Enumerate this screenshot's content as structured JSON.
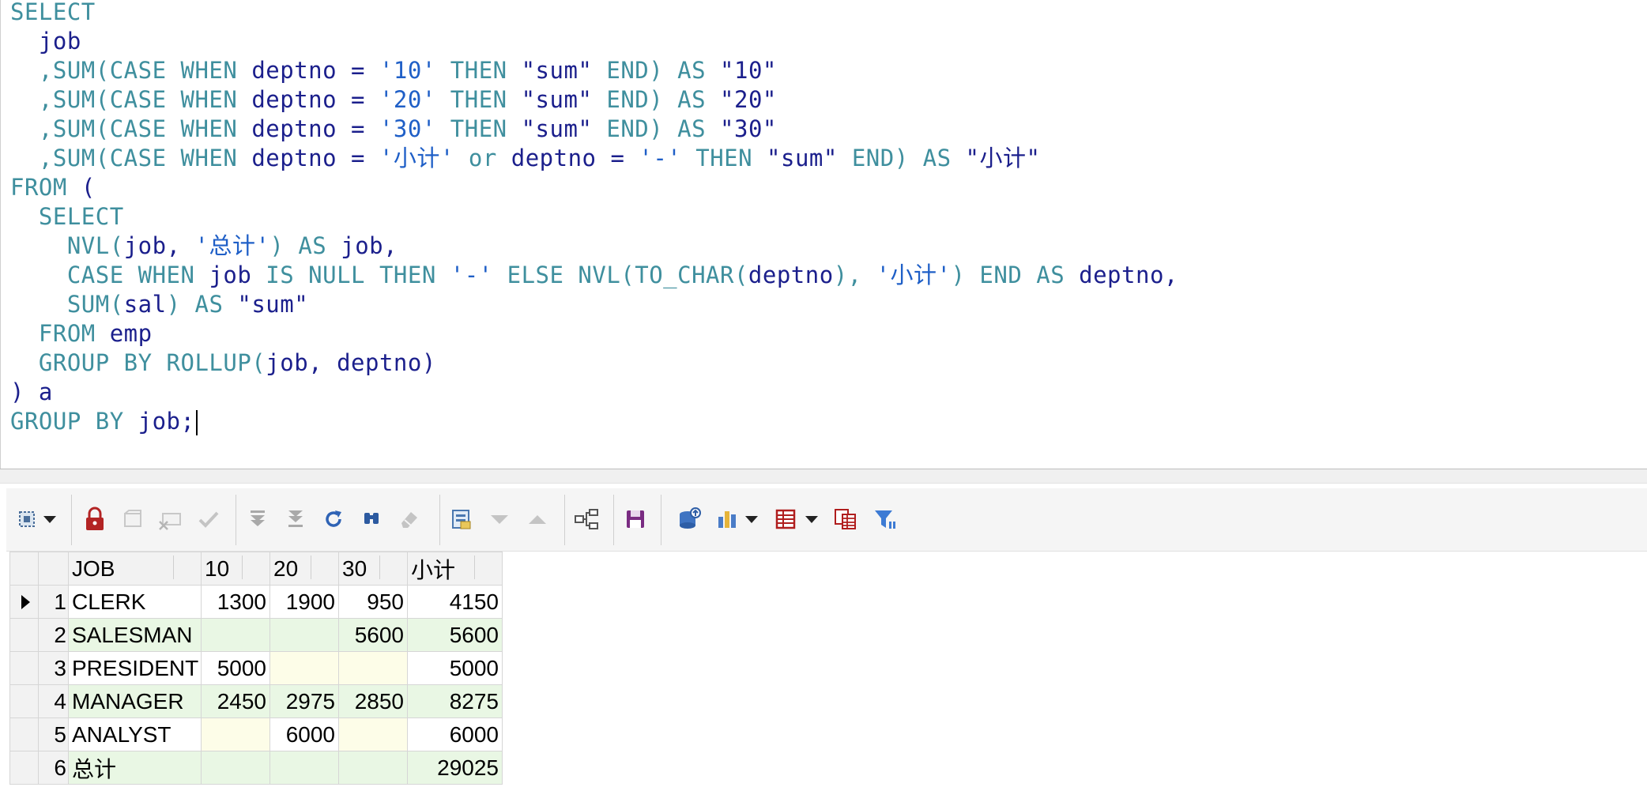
{
  "editor": {
    "lines": [
      [
        {
          "t": "SELECT",
          "k": "kw"
        }
      ],
      [
        {
          "t": "  job",
          "k": "id"
        }
      ],
      [
        {
          "t": "  ,SUM(",
          "k": "kw"
        },
        {
          "t": "CASE WHEN ",
          "k": "kw"
        },
        {
          "t": "deptno ",
          "k": "id"
        },
        {
          "t": "= ",
          "k": "id"
        },
        {
          "t": "'10' ",
          "k": "str"
        },
        {
          "t": "THEN ",
          "k": "kw"
        },
        {
          "t": "\"sum\" ",
          "k": "dstr"
        },
        {
          "t": "END) AS ",
          "k": "kw"
        },
        {
          "t": "\"10\"",
          "k": "dstr"
        }
      ],
      [
        {
          "t": "  ,SUM(",
          "k": "kw"
        },
        {
          "t": "CASE WHEN ",
          "k": "kw"
        },
        {
          "t": "deptno ",
          "k": "id"
        },
        {
          "t": "= ",
          "k": "id"
        },
        {
          "t": "'20' ",
          "k": "str"
        },
        {
          "t": "THEN ",
          "k": "kw"
        },
        {
          "t": "\"sum\" ",
          "k": "dstr"
        },
        {
          "t": "END) AS ",
          "k": "kw"
        },
        {
          "t": "\"20\"",
          "k": "dstr"
        }
      ],
      [
        {
          "t": "  ,SUM(",
          "k": "kw"
        },
        {
          "t": "CASE WHEN ",
          "k": "kw"
        },
        {
          "t": "deptno ",
          "k": "id"
        },
        {
          "t": "= ",
          "k": "id"
        },
        {
          "t": "'30' ",
          "k": "str"
        },
        {
          "t": "THEN ",
          "k": "kw"
        },
        {
          "t": "\"sum\" ",
          "k": "dstr"
        },
        {
          "t": "END) AS ",
          "k": "kw"
        },
        {
          "t": "\"30\"",
          "k": "dstr"
        }
      ],
      [
        {
          "t": "  ,SUM(",
          "k": "kw"
        },
        {
          "t": "CASE WHEN ",
          "k": "kw"
        },
        {
          "t": "deptno ",
          "k": "id"
        },
        {
          "t": "= ",
          "k": "id"
        },
        {
          "t": "'小计' ",
          "k": "str"
        },
        {
          "t": "or ",
          "k": "kw"
        },
        {
          "t": "deptno ",
          "k": "id"
        },
        {
          "t": "= ",
          "k": "id"
        },
        {
          "t": "'-' ",
          "k": "str"
        },
        {
          "t": "THEN ",
          "k": "kw"
        },
        {
          "t": "\"sum\" ",
          "k": "dstr"
        },
        {
          "t": "END) AS ",
          "k": "kw"
        },
        {
          "t": "\"小计\"",
          "k": "dstr"
        }
      ],
      [
        {
          "t": "FROM ",
          "k": "kw"
        },
        {
          "t": "(",
          "k": "id"
        }
      ],
      [
        {
          "t": "  SELECT",
          "k": "kw"
        }
      ],
      [
        {
          "t": "    NVL(",
          "k": "kw"
        },
        {
          "t": "job, ",
          "k": "id"
        },
        {
          "t": "'总计'",
          "k": "str"
        },
        {
          "t": ") AS ",
          "k": "kw"
        },
        {
          "t": "job,",
          "k": "id"
        }
      ],
      [
        {
          "t": "    CASE WHEN ",
          "k": "kw"
        },
        {
          "t": "job ",
          "k": "id"
        },
        {
          "t": "IS NULL THEN ",
          "k": "kw"
        },
        {
          "t": "'-' ",
          "k": "str"
        },
        {
          "t": "ELSE NVL(TO_CHAR(",
          "k": "kw"
        },
        {
          "t": "deptno",
          "k": "id"
        },
        {
          "t": "), ",
          "k": "kw"
        },
        {
          "t": "'小计'",
          "k": "str"
        },
        {
          "t": ") END AS ",
          "k": "kw"
        },
        {
          "t": "deptno,",
          "k": "id"
        }
      ],
      [
        {
          "t": "    SUM(",
          "k": "kw"
        },
        {
          "t": "sal",
          "k": "id"
        },
        {
          "t": ") AS ",
          "k": "kw"
        },
        {
          "t": "\"sum\"",
          "k": "dstr"
        }
      ],
      [
        {
          "t": "  FROM ",
          "k": "kw"
        },
        {
          "t": "emp",
          "k": "id"
        }
      ],
      [
        {
          "t": "  GROUP BY ROLLUP(",
          "k": "kw"
        },
        {
          "t": "job, deptno)",
          "k": "id"
        }
      ],
      [
        {
          "t": ") a",
          "k": "id"
        }
      ],
      [
        {
          "t": "GROUP BY ",
          "k": "kw"
        },
        {
          "t": "job;",
          "k": "id"
        }
      ]
    ]
  },
  "toolbar": {
    "icons": [
      "select-mode-icon",
      "dropdown-arrow-icon",
      "lock-icon",
      "insert-record-icon",
      "delete-record-icon",
      "post-edits-icon",
      "fetch-next-icon",
      "fetch-all-icon",
      "refresh-icon",
      "find-icon",
      "clear-icon",
      "single-record-view-icon",
      "next-record-icon",
      "previous-record-icon",
      "query-by-example-icon",
      "save-icon",
      "export-icon",
      "chart-icon",
      "chart-dropdown-icon",
      "grid-view-icon",
      "grid-dropdown-icon",
      "multi-grid-icon",
      "filter-icon"
    ]
  },
  "grid": {
    "columns": [
      "JOB",
      "10",
      "20",
      "30",
      "小计"
    ],
    "rows": [
      {
        "num": "1",
        "job": "CLERK",
        "c10": "1300",
        "c20": "1900",
        "c30": "950",
        "total": "4150"
      },
      {
        "num": "2",
        "job": "SALESMAN",
        "c10": "",
        "c20": "",
        "c30": "5600",
        "total": "5600"
      },
      {
        "num": "3",
        "job": "PRESIDENT",
        "c10": "5000",
        "c20": "",
        "c30": "",
        "total": "5000"
      },
      {
        "num": "4",
        "job": "MANAGER",
        "c10": "2450",
        "c20": "2975",
        "c30": "2850",
        "total": "8275"
      },
      {
        "num": "5",
        "job": "ANALYST",
        "c10": "",
        "c20": "6000",
        "c30": "",
        "total": "6000"
      },
      {
        "num": "6",
        "job": "总计",
        "c10": "",
        "c20": "",
        "c30": "",
        "total": "29025"
      }
    ],
    "current_row": 0
  },
  "colors": {
    "keyword": "#3f8f9e",
    "identifier": "#1b1f8c",
    "string": "#1f5fc7",
    "row_alt": "#e9f7e4",
    "row_empty": "#fdfde8"
  }
}
